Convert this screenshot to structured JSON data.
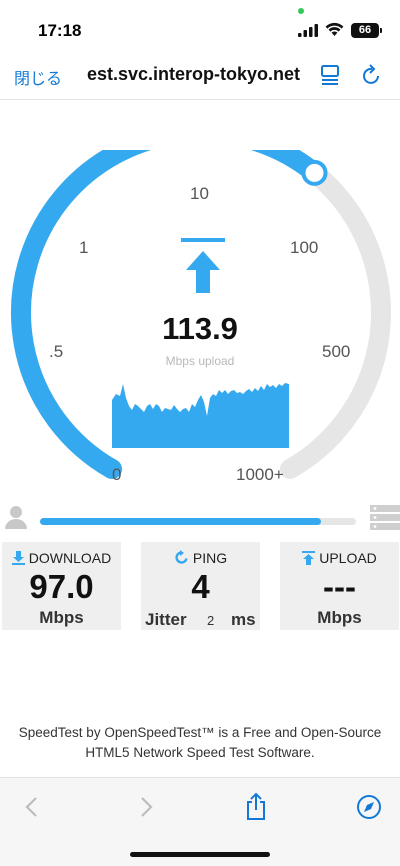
{
  "status_bar": {
    "time": "17:18",
    "battery": "66"
  },
  "nav": {
    "close_label": "閉じる",
    "url_text": "est.svc.interop-tokyo.net"
  },
  "gauge": {
    "scale_labels": [
      "0",
      ".5",
      "1",
      "10",
      "100",
      "500",
      "1000+"
    ],
    "reading": "113.9",
    "unit_label": "Mbps upload",
    "arc_progress": 0.63
  },
  "progress": {
    "fraction": 0.89
  },
  "cards": {
    "download": {
      "title": "DOWNLOAD",
      "value": "97.0",
      "unit": "Mbps"
    },
    "ping": {
      "title": "PING",
      "value": "4",
      "jitter_label": "Jitter",
      "jitter_value": "2",
      "jitter_unit": "ms"
    },
    "upload": {
      "title": "UPLOAD",
      "value": "---",
      "unit": "Mbps"
    }
  },
  "footer": {
    "line1": "SpeedTest by OpenSpeedTest™ is a Free and Open-Source",
    "line2": "HTML5 Network Speed Test Software."
  },
  "colors": {
    "accent": "#35a9ef",
    "link": "#1479d4",
    "track": "#e6e6e6",
    "card_bg": "#efefef"
  },
  "icons": [
    "signal-icon",
    "wifi-icon",
    "battery-icon",
    "reader-icon",
    "reload-icon",
    "upload-arrow-icon",
    "user-icon",
    "server-icon",
    "download-icon",
    "refresh-icon",
    "upload-icon",
    "back-icon",
    "forward-icon",
    "share-icon",
    "compass-icon"
  ]
}
